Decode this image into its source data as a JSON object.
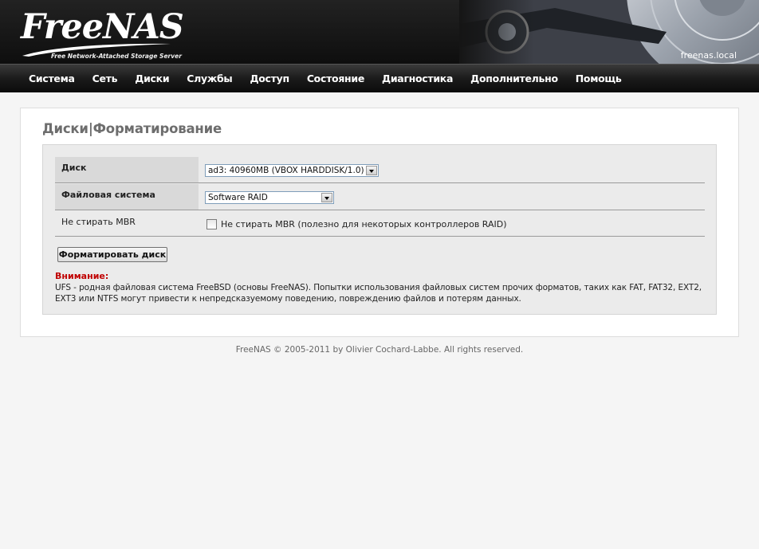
{
  "header": {
    "logo_name": "FreeNAS",
    "logo_tagline": "Free Network-Attached Storage Server",
    "hostname": "freenas.local"
  },
  "nav": {
    "items": [
      {
        "label": "Система"
      },
      {
        "label": "Сеть"
      },
      {
        "label": "Диски"
      },
      {
        "label": "Службы"
      },
      {
        "label": "Доступ"
      },
      {
        "label": "Состояние"
      },
      {
        "label": "Диагностика"
      },
      {
        "label": "Дополнительно"
      },
      {
        "label": "Помощь"
      }
    ]
  },
  "page": {
    "title_section": "Диски",
    "title_separator": "|",
    "title_page": "Форматирование"
  },
  "form": {
    "disk": {
      "label": "Диск",
      "value": "ad3: 40960MB (VBOX HARDDISK/1.0)"
    },
    "filesystem": {
      "label": "Файловая система",
      "value": "Software RAID"
    },
    "mbr": {
      "label": "Не стирать MBR",
      "checkbox_label": "Не стирать MBR (полезно для некоторых контроллеров RAID)",
      "checked": false
    },
    "submit_label": "Форматировать диск"
  },
  "warning": {
    "title": "Внимание:",
    "text": "UFS - родная файловая система FreeBSD (основы FreeNAS). Попытки использования файловых систем прочих форматов, таких как FAT, FAT32, EXT2, EXT3 или NTFS могут привести к непредсказуемому поведению, повреждению файлов и потерям данных."
  },
  "footer": {
    "text": "FreeNAS © 2005-2011 by Olivier Cochard-Labbe. All rights reserved."
  },
  "colors": {
    "header_bg": "#151515",
    "nav_text": "#ffffff",
    "title": "#6d6d6d",
    "warning_title": "#c00000",
    "panel_bg": "#ebebeb"
  }
}
